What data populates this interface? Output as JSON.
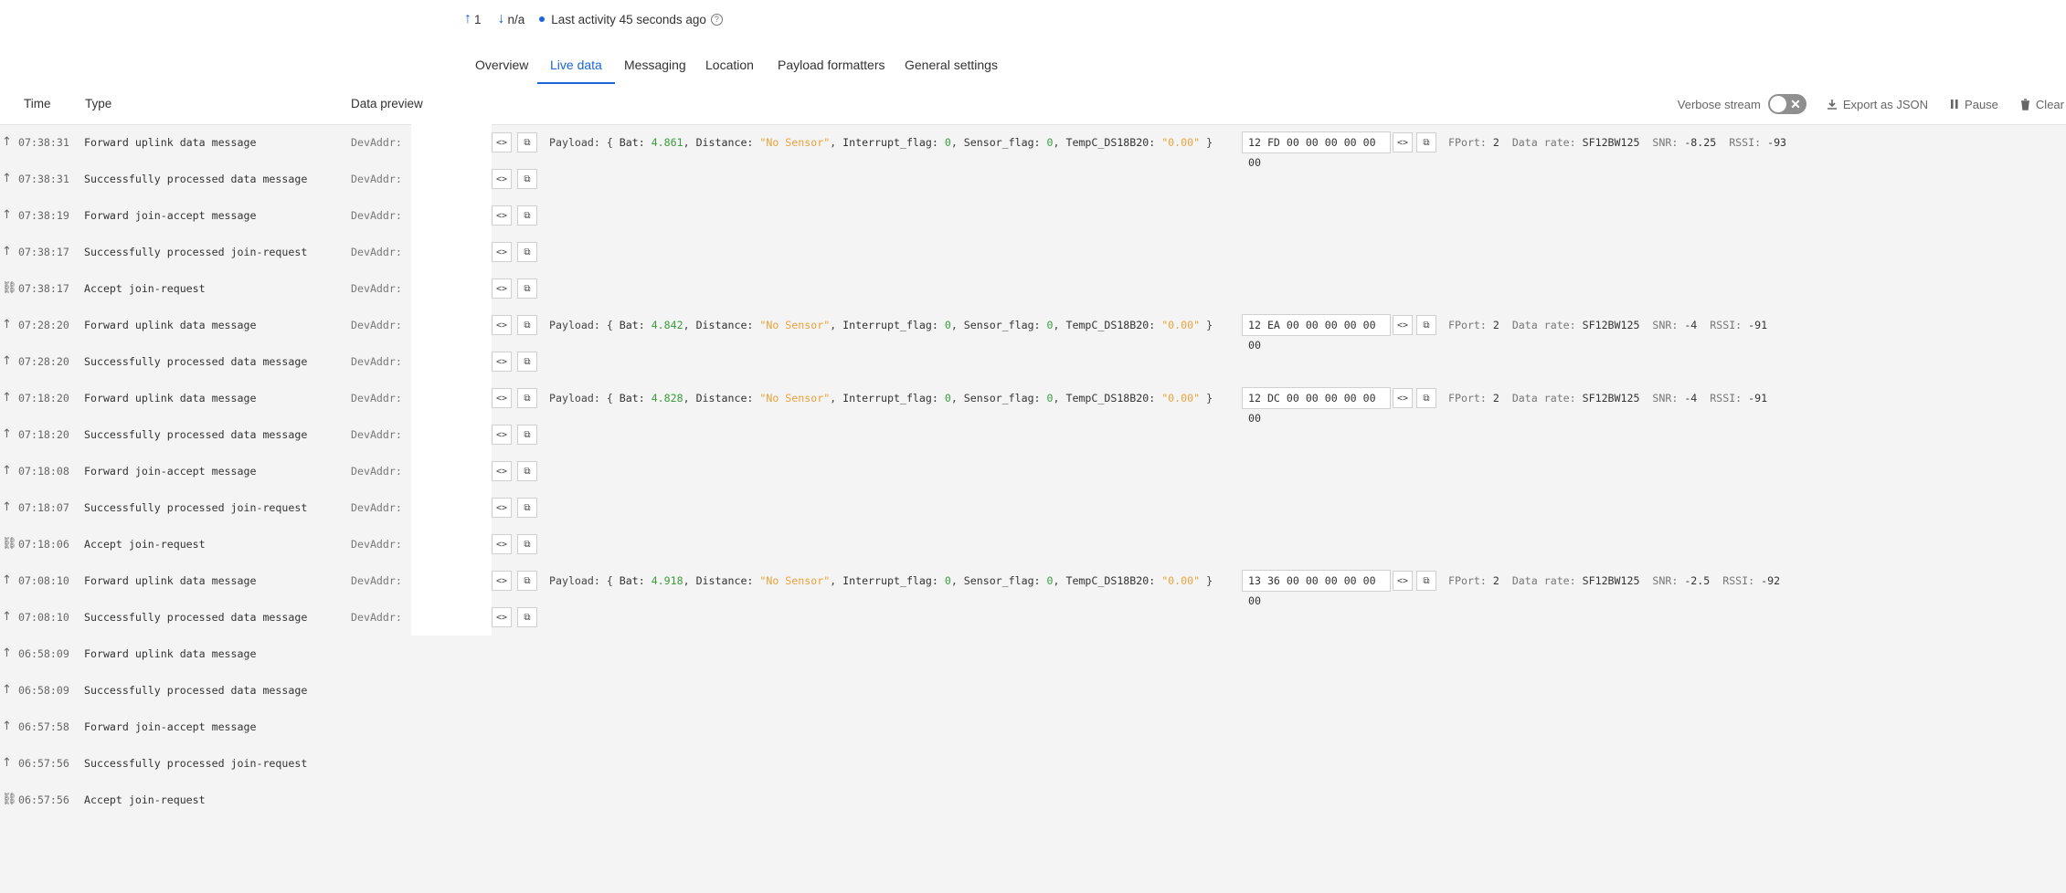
{
  "status": {
    "uplink_count": "1",
    "downlink_count": "n/a",
    "last_activity": "Last activity 45 seconds ago"
  },
  "tabs": [
    {
      "label": "Overview"
    },
    {
      "label": "Live data",
      "active": true
    },
    {
      "label": "Messaging"
    },
    {
      "label": "Location"
    },
    {
      "label": "Payload formatters"
    },
    {
      "label": "General settings"
    }
  ],
  "table": {
    "headers": {
      "time": "Time",
      "type": "Type",
      "preview": "Data preview"
    },
    "tools": {
      "verbose": "Verbose stream",
      "export": "Export as JSON",
      "pause": "Pause",
      "clear": "Clear"
    }
  },
  "rows": [
    {
      "icon": "up-arrow-icon",
      "time": "07:38:31",
      "type": "Forward uplink data message",
      "dev": "DevAddr:",
      "payload": {
        "bat": "4.861"
      },
      "hex": "12 FD 00 00 00 00 00 00",
      "fport": "2",
      "datarate": "SF12BW125",
      "snr": "-8.25",
      "rssi": "-93"
    },
    {
      "icon": "up-arrow-icon",
      "time": "07:38:31",
      "type": "Successfully processed data message",
      "dev": "DevAddr:"
    },
    {
      "icon": "up-arrow-icon",
      "time": "07:38:19",
      "type": "Forward join-accept message",
      "dev": "DevAddr:"
    },
    {
      "icon": "up-arrow-icon",
      "time": "07:38:17",
      "type": "Successfully processed join-request",
      "dev": "DevAddr:"
    },
    {
      "icon": "link-icon",
      "time": "07:38:17",
      "type": "Accept join-request",
      "dev": "DevAddr:"
    },
    {
      "icon": "up-arrow-icon",
      "time": "07:28:20",
      "type": "Forward uplink data message",
      "dev": "DevAddr:",
      "payload": {
        "bat": "4.842"
      },
      "hex": "12 EA 00 00 00 00 00 00",
      "fport": "2",
      "datarate": "SF12BW125",
      "snr": "-4",
      "rssi": "-91"
    },
    {
      "icon": "up-arrow-icon",
      "time": "07:28:20",
      "type": "Successfully processed data message",
      "dev": "DevAddr:"
    },
    {
      "icon": "up-arrow-icon",
      "time": "07:18:20",
      "type": "Forward uplink data message",
      "dev": "DevAddr:",
      "payload": {
        "bat": "4.828"
      },
      "hex": "12 DC 00 00 00 00 00 00",
      "fport": "2",
      "datarate": "SF12BW125",
      "snr": "-4",
      "rssi": "-91"
    },
    {
      "icon": "up-arrow-icon",
      "time": "07:18:20",
      "type": "Successfully processed data message",
      "dev": "DevAddr:"
    },
    {
      "icon": "up-arrow-icon",
      "time": "07:18:08",
      "type": "Forward join-accept message",
      "dev": "DevAddr:"
    },
    {
      "icon": "up-arrow-icon",
      "time": "07:18:07",
      "type": "Successfully processed join-request",
      "dev": "DevAddr:"
    },
    {
      "icon": "link-icon",
      "time": "07:18:06",
      "type": "Accept join-request",
      "dev": "DevAddr:"
    },
    {
      "icon": "up-arrow-icon",
      "time": "07:08:10",
      "type": "Forward uplink data message",
      "dev": "DevAddr:",
      "payload": {
        "bat": "4.918"
      },
      "hex": "13 36 00 00 00 00 00 00",
      "fport": "2",
      "datarate": "SF12BW125",
      "snr": "-2.5",
      "rssi": "-92"
    },
    {
      "icon": "up-arrow-icon",
      "time": "07:08:10",
      "type": "Successfully processed data message",
      "dev": "DevAddr:"
    },
    {
      "icon": "up-arrow-icon",
      "time": "06:58:09",
      "type": "Forward uplink data message"
    },
    {
      "icon": "up-arrow-icon",
      "time": "06:58:09",
      "type": "Successfully processed data message"
    },
    {
      "icon": "up-arrow-icon",
      "time": "06:57:58",
      "type": "Forward join-accept message"
    },
    {
      "icon": "up-arrow-icon",
      "time": "06:57:56",
      "type": "Successfully processed join-request"
    },
    {
      "icon": "link-icon",
      "time": "06:57:56",
      "type": "Accept join-request"
    }
  ],
  "payload_fields": {
    "label": "Payload:",
    "open": "{",
    "close": "}",
    "bat_key": "Bat:",
    "distance_key": "Distance:",
    "distance_val": "\"No Sensor\"",
    "interrupt_key": "Interrupt_flag:",
    "interrupt_val": "0",
    "sensor_key": "Sensor_flag:",
    "sensor_val": "0",
    "temp_key": "TempC_DS18B20:",
    "temp_val": "\"0.00\"",
    "fport_label": "FPort:",
    "datarate_label": "Data rate:",
    "snr_label": "SNR:",
    "rssi_label": "RSSI:"
  },
  "colors": {
    "accent": "#1b66d6",
    "number": "#3a9c3a",
    "string": "#e8a33a"
  }
}
